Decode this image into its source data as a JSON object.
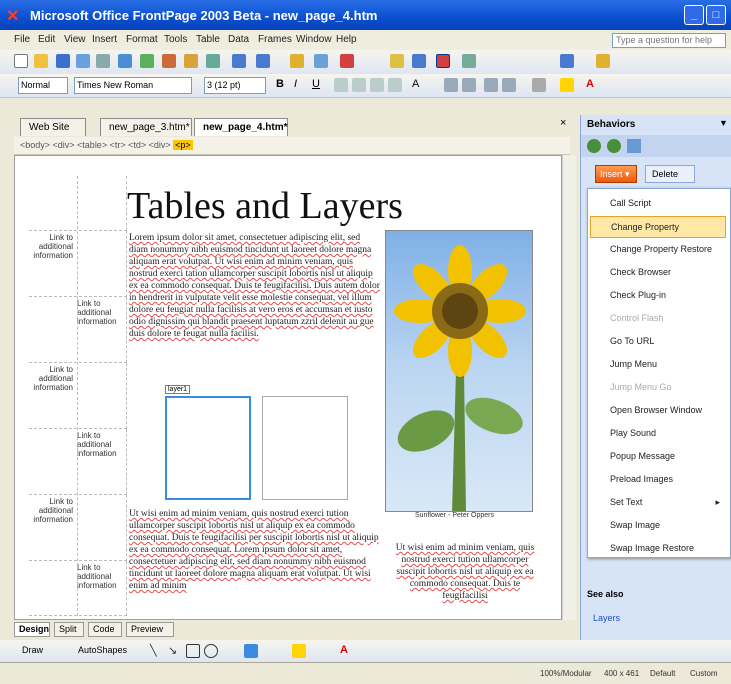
{
  "window": {
    "title": "Microsoft Office FrontPage 2003 Beta - new_page_4.htm"
  },
  "menu": [
    "File",
    "Edit",
    "View",
    "Insert",
    "Format",
    "Tools",
    "Table",
    "Data",
    "Frames",
    "Window",
    "Help"
  ],
  "help_placeholder": "Type a question for help",
  "format": {
    "style": "Normal",
    "font": "Times New Roman",
    "size": "3 (12 pt)"
  },
  "tabs": [
    "Web Site",
    "new_page_3.htm*",
    "new_page_4.htm*"
  ],
  "quicktag": {
    "path": "<body> <div> <table> <tr> <td> <div>",
    "current": "<p>"
  },
  "doc": {
    "heading": "Tables and Layers",
    "link_text": "Link to additional information",
    "lorem1": "Lorem ipsum dolor sit amet, consectetuer adipiscing elit, sed diam nonummy nibh euismod tincidunt ut laoreet dolore magna aliquam erat volutpat. Ut wisi enim ad minim veniam, quis nostrud exerci tation ullamcorper suscipit lobortis nisl ut aliquip ex ea commodo consequat. Duis te feugifacilisi. Duis autem dolor in hendrerit in vulputate velit esse molestie consequat, vel illum dolore eu feugiat nulla facilisis at vero eros et accumsan et iusto odio dignissim qui blandit praesent luptatum zzril delenit au gue duis dolore te feugat nulla facilisi.",
    "layer_tag": "layer1",
    "lorem2": "Ut wisi enim ad minim veniam, quis nostrud exerci tution ullamcorper suscipit lobortis nisl ut aliquip ex ea commodo consequat. Duis te feugifacilisi per suscipit lobortis nisl ut aliquip ex ea commodo consequat. Lorem ipsum dolor sit amet, consectetuer adipiscing elit, sed diam nonummy nibh euismod tincidunt ut laoreet dolore magna aliquam erat volutpat. Ut wisi enim ad minim",
    "lorem3": "Ut wisi enim ad minim veniam, quis nostrud exerci tution ullamcorper suscipit lobortis nisl ut aliquip ex ea commodo consequat. Duis te feugifacilisi",
    "photo_caption": "Sunflower - Peter Oppers"
  },
  "viewtabs": [
    "Design",
    "Split",
    "Code",
    "Preview"
  ],
  "drawbar": {
    "draw": "Draw",
    "autoshapes": "AutoShapes"
  },
  "status": {
    "conn": "100%/Modular",
    "size": "400 x 461",
    "mode": "Default",
    "custom": "Custom"
  },
  "taskpane": {
    "title": "Behaviors",
    "events_btn": "Insert ▾",
    "delete_btn": "Delete",
    "see_also": "See also",
    "layers_link": "Layers"
  },
  "behaviors": [
    {
      "label": "Call Script",
      "disabled": false
    },
    {
      "label": "Change Property",
      "disabled": false,
      "hover": true
    },
    {
      "label": "Change Property Restore",
      "disabled": false
    },
    {
      "label": "Check Browser",
      "disabled": false
    },
    {
      "label": "Check Plug-in",
      "disabled": false
    },
    {
      "label": "Control Flash",
      "disabled": true
    },
    {
      "label": "Go To URL",
      "disabled": false
    },
    {
      "label": "Jump Menu",
      "disabled": false
    },
    {
      "label": "Jump Menu Go",
      "disabled": true
    },
    {
      "label": "Open Browser Window",
      "disabled": false
    },
    {
      "label": "Play Sound",
      "disabled": false
    },
    {
      "label": "Popup Message",
      "disabled": false
    },
    {
      "label": "Preload Images",
      "disabled": false
    },
    {
      "label": "Set Text",
      "disabled": false,
      "submenu": true
    },
    {
      "label": "Swap Image",
      "disabled": false
    },
    {
      "label": "Swap Image Restore",
      "disabled": false
    }
  ]
}
